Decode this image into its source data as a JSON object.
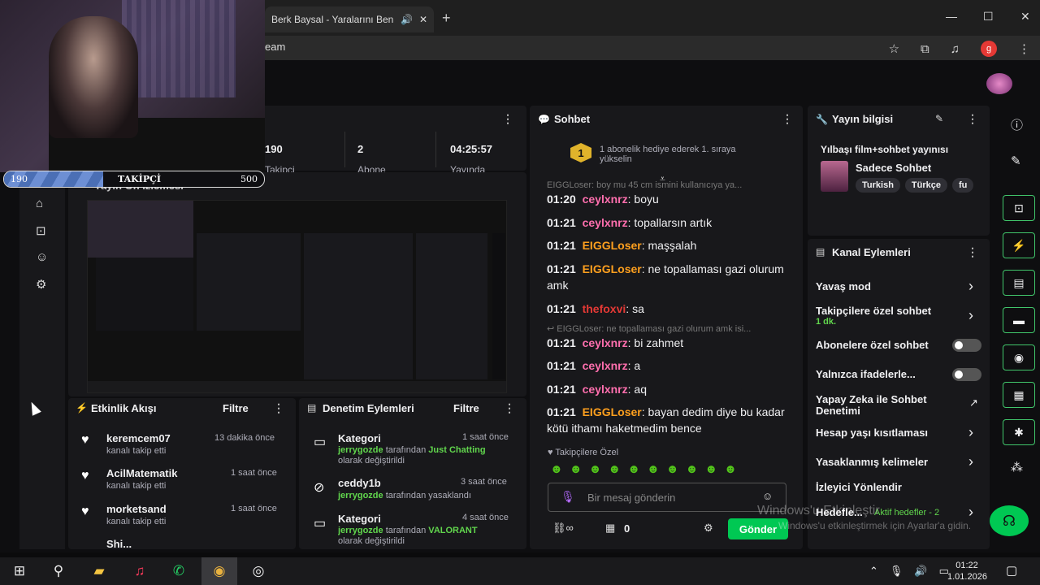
{
  "browser": {
    "tab_title": "Berk Baysal - Yaralarını Ben",
    "tab_icons": [
      "speaker-icon",
      "close-icon"
    ],
    "new_tab": "+",
    "url_fragment": "eam",
    "window_controls": [
      "—",
      "☐",
      "✕"
    ],
    "profile_initial": "g"
  },
  "follower_goal": {
    "current": "190",
    "label": "TAKİPÇİ",
    "goal": "500",
    "progress": 0.38
  },
  "stats": [
    {
      "value": "190",
      "label": "Takipçi"
    },
    {
      "value": "2",
      "label": "Abone"
    },
    {
      "value": "04:25:57",
      "label": "Yayında"
    }
  ],
  "preview": {
    "title": "Yayın Ön İzlemesi"
  },
  "activity": {
    "title": "Etkinlik Akışı",
    "filter": "Filtre",
    "items": [
      {
        "name": "keremcem07",
        "action": "kanalı takip etti",
        "time": "13 dakika önce"
      },
      {
        "name": "AcilMatematik",
        "action": "kanalı takip etti",
        "time": "1 saat önce"
      },
      {
        "name": "morketsand",
        "action": "kanalı takip etti",
        "time": "1 saat önce"
      },
      {
        "name": "Shi...",
        "action": "",
        "time": ""
      }
    ]
  },
  "modlog": {
    "title": "Denetim Eylemleri",
    "filter": "Filtre",
    "items": [
      {
        "title": "Kategori",
        "time": "1 saat önce",
        "user": "jerrygozde",
        "mid": " tarafından ",
        "value": "Just Chatting",
        "tail": "olarak değiştirildi"
      },
      {
        "title": "ceddy1b",
        "time": "3 saat önce",
        "user": "jerrygozde",
        "mid": " tarafından yasaklandı",
        "value": "",
        "tail": ""
      },
      {
        "title": "Kategori",
        "time": "4 saat önce",
        "user": "jerrygozde",
        "mid": " tarafından ",
        "value": "VALORANT",
        "tail": "olarak değiştirildi"
      }
    ]
  },
  "chat": {
    "title": "Sohbet",
    "hype_rank": "1",
    "hype_text": "1 abonelik hediye ederek 1. sıraya yükselin",
    "pinned_fragment": "EIGGLoser: boy mu 45 cm ismini kullanıcıya ya...",
    "messages": [
      {
        "time": "01:20",
        "nick": "ceylxnrz",
        "color": "#ff6fae",
        "text": "boyu"
      },
      {
        "time": "01:21",
        "nick": "ceylxnrz",
        "color": "#ff6fae",
        "text": "topallarsın artık"
      },
      {
        "time": "01:21",
        "nick": "EIGGLoser",
        "color": "#ffa01e",
        "text": "maşşalah"
      },
      {
        "time": "01:21",
        "nick": "EIGGLoser",
        "color": "#ffa01e",
        "text": "ne topallaması gazi olurum amk"
      },
      {
        "time": "01:21",
        "nick": "thefoxvi",
        "color": "#e53935",
        "text": "sa"
      },
      {
        "time": "01:21",
        "nick": "ceylxnrz",
        "color": "#ff6fae",
        "text": "bi zahmet"
      },
      {
        "time": "01:21",
        "nick": "ceylxnrz",
        "color": "#ff6fae",
        "text": "a"
      },
      {
        "time": "01:21",
        "nick": "ceylxnrz",
        "color": "#ff6fae",
        "text": "aq"
      },
      {
        "time": "01:21",
        "nick": "EIGGLoser",
        "color": "#ffa01e",
        "text": "bayan dedim diye bu kadar kötü ithamı haketmedim bence"
      }
    ],
    "reply_preview": "EIGGLoser: ne topallaması gazi olurum amk isi...",
    "followers_only": "Takipçilere Özel",
    "input_placeholder": "Bir mesaj gönderin",
    "points": "0",
    "send_label": "Gönder"
  },
  "stream_info": {
    "title": "Yayın bilgisi",
    "stream_title": "Yılbaşı film+sohbet yayınısı",
    "category": "Sadece Sohbet",
    "tags": [
      "Turkish",
      "Türkçe",
      "fu"
    ]
  },
  "channel_actions": {
    "title": "Kanal Eylemleri",
    "items": [
      {
        "label": "Yavaş mod",
        "sub": "",
        "control": "chevron"
      },
      {
        "label": "Takipçilere özel sohbet",
        "sub": "1 dk.",
        "control": "chevron"
      },
      {
        "label": "Abonelere özel sohbet",
        "sub": "",
        "control": "toggle"
      },
      {
        "label": "Yalnızca ifadelerle...",
        "sub": "",
        "control": "toggle"
      },
      {
        "label": "Yapay Zeka ile Sohbet Denetimi",
        "sub": "",
        "control": "external"
      },
      {
        "label": "Hesap yaşı kısıtlaması",
        "sub": "",
        "control": "chevron"
      },
      {
        "label": "Yasaklanmış kelimeler",
        "sub": "",
        "control": "chevron"
      },
      {
        "label": "İzleyici Yönlendir",
        "sub": "",
        "control": "none"
      },
      {
        "label": "Hedefle...",
        "sub": "Aktif hedefler - 2",
        "control": "chevron"
      }
    ]
  },
  "watermark": {
    "line1": "Windows'u Etkinleştir",
    "line2": "Windows'u etkinleştirmek için Ayarlar'a gidin."
  },
  "taskbar": {
    "time": "01:22",
    "date": "1.01.2026"
  },
  "colors": {
    "accent_green": "#00c853",
    "panel_bg": "#18181b",
    "page_bg": "#0e0e10"
  }
}
